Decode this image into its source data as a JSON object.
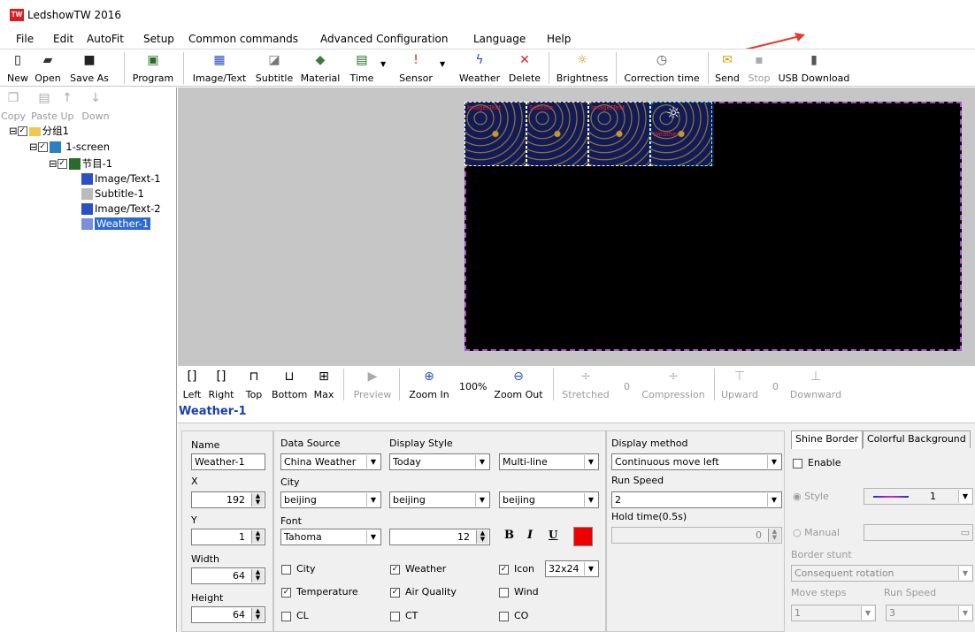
{
  "app": {
    "title": "LedshowTW 2016",
    "icon_text": "TW"
  },
  "menu": [
    "File",
    "Edit",
    "AutoFit",
    "Setup",
    "Common commands",
    "Advanced Configuration",
    "Language",
    "Help"
  ],
  "toolbar": {
    "new": "New",
    "open": "Open",
    "save_as": "Save As",
    "program": "Program",
    "image_text": "Image/Text",
    "subtitle": "Subtitle",
    "material": "Material",
    "time": "Time",
    "sensor": "Sensor",
    "weather": "Weather",
    "delete": "Delete",
    "brightness": "Brightness",
    "correction_time": "Correction time",
    "send": "Send",
    "stop": "Stop",
    "usb_download": "USB Download"
  },
  "left_toolbar": {
    "copy": "Copy",
    "paste": "Paste",
    "up": "Up",
    "down": "Down"
  },
  "tree": {
    "group": "分组1",
    "screen": "1-screen",
    "program": "节目-1",
    "items": [
      "Image/Text-1",
      "Subtitle-1",
      "Image/Text-2",
      "Weather-1"
    ],
    "selected": "Weather-1"
  },
  "bottom_toolbar": {
    "left": "Left",
    "right": "Right",
    "top": "Top",
    "bottom": "Bottom",
    "max": "Max",
    "preview": "Preview",
    "zoom_in": "Zoom In",
    "zoom_level": "100%",
    "zoom_out": "Zoom Out",
    "stretched": "Stretched",
    "stretched_val": "0",
    "compression": "Compression",
    "upward": "Upward",
    "upward_val": "0",
    "downward": "Downward"
  },
  "selected_title": "Weather-1",
  "props": {
    "name_label": "Name",
    "name": "Weather-1",
    "x_label": "X",
    "x": "192",
    "y_label": "Y",
    "y": "1",
    "width_label": "Width",
    "width": "64",
    "height_label": "Height",
    "height": "64",
    "data_source_label": "Data Source",
    "data_source": "China Weather",
    "display_style_label": "Display Style",
    "display_style": "Today",
    "line_mode": "Multi-line",
    "city_label": "City",
    "city1": "beijing",
    "city2": "beijing",
    "city3": "beijing",
    "font_label": "Font",
    "font": "Tahoma",
    "font_size": "12",
    "bold": "B",
    "italic": "I",
    "underline": "U",
    "font_color": "#ee0000",
    "checks": {
      "city": "City",
      "weather": "Weather",
      "icon": "Icon",
      "icon_size": "32x24",
      "temperature": "Temperature",
      "air_quality": "Air Quality",
      "wind": "Wind",
      "cl": "CL",
      "ct": "CT",
      "co": "CO"
    },
    "display_method_label": "Display method",
    "display_method": "Continuous move left",
    "run_speed_label": "Run Speed",
    "run_speed": "2",
    "hold_time_label": "Hold time(0.5s)",
    "hold_time": "0"
  },
  "border": {
    "tab_shine": "Shine Border",
    "tab_colorful": "Colorful Background",
    "enable": "Enable",
    "style": "Style",
    "style_value": "1",
    "manual": "Manual",
    "border_stunt_label": "Border stunt",
    "border_stunt": "Consequent rotation",
    "move_steps_label": "Move steps",
    "move_steps": "1",
    "run_speed_label": "Run Speed",
    "run_speed": "3"
  },
  "tiles": [
    "Image/Text",
    "Subtitle",
    "Image/Text",
    "Weather"
  ]
}
